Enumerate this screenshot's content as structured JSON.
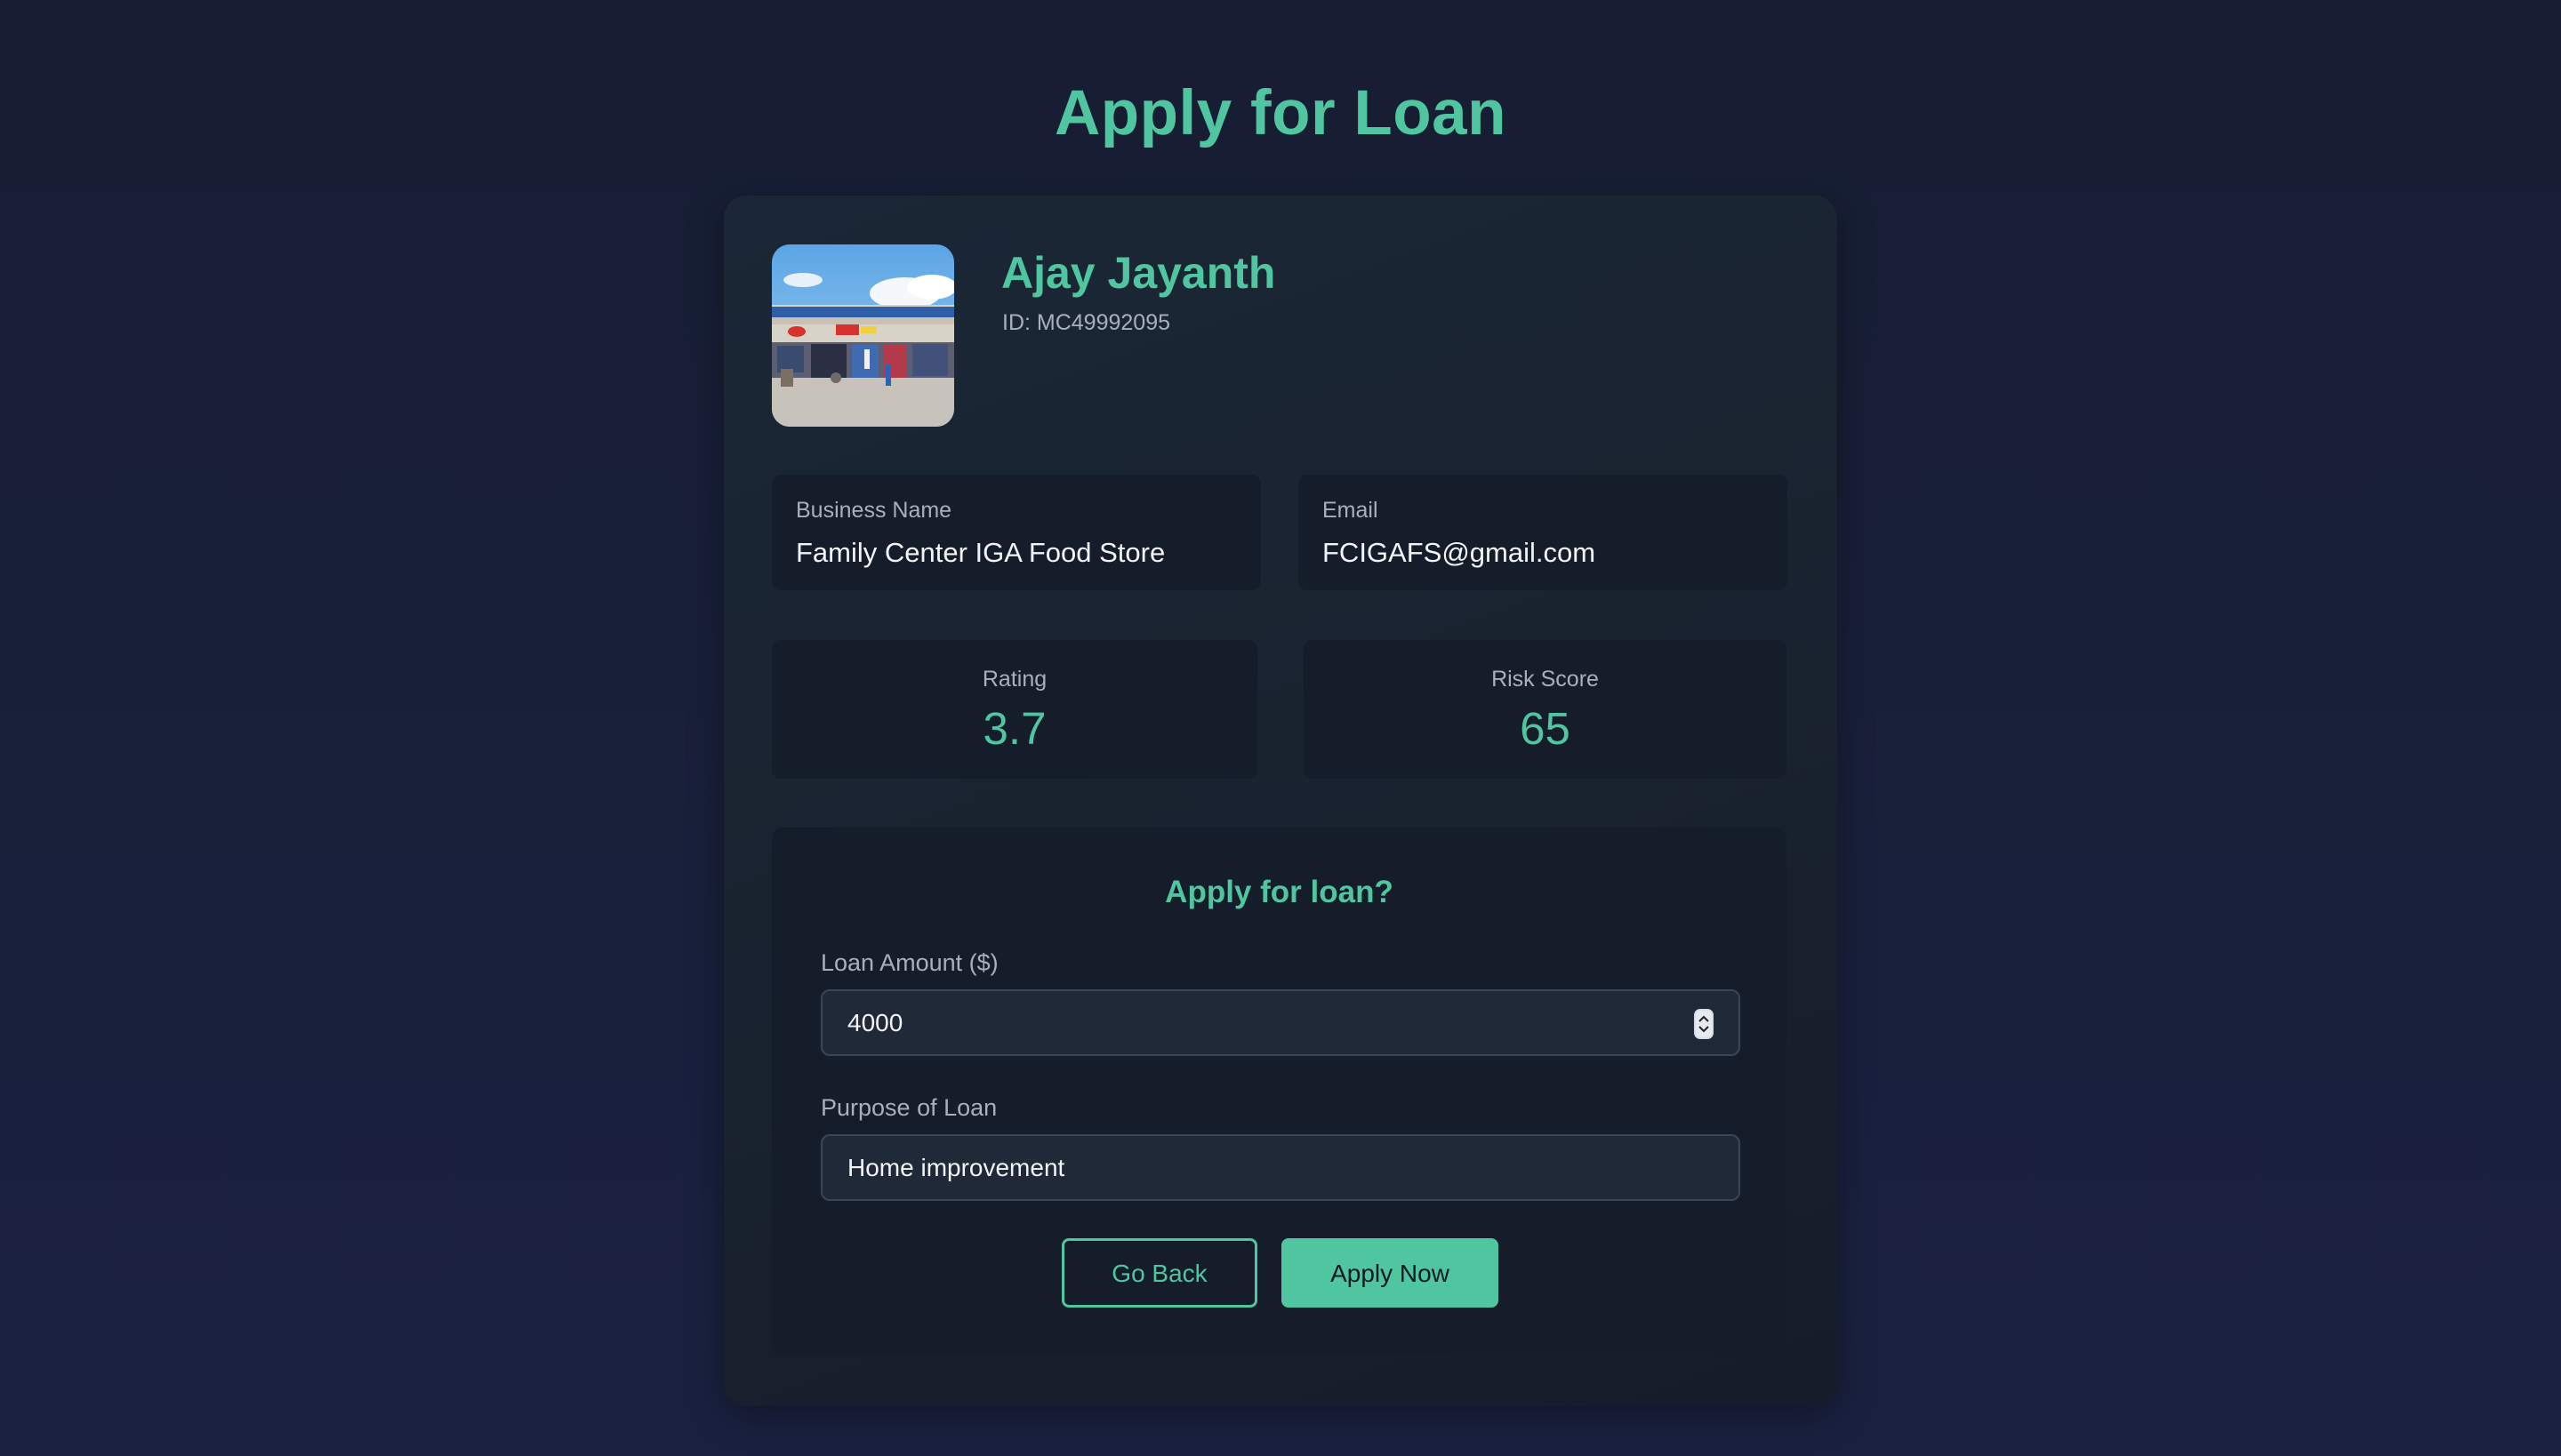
{
  "page": {
    "title": "Apply for Loan"
  },
  "profile": {
    "name": "Ajay Jayanth",
    "id_text": "ID: MC49992095",
    "avatar_image": "storefront photo"
  },
  "info": {
    "business_label": "Business Name",
    "business_value": "Family Center IGA Food Store",
    "email_label": "Email",
    "email_value": "FCIGAFS@gmail.com"
  },
  "stats": {
    "rating_label": "Rating",
    "rating_value": "3.7",
    "risk_label": "Risk Score",
    "risk_value": "65"
  },
  "loan_form": {
    "title": "Apply for loan?",
    "amount_label": "Loan Amount ($)",
    "amount_value": "4000",
    "purpose_label": "Purpose of Loan",
    "purpose_value": "Home improvement",
    "back_button": "Go Back",
    "apply_button": "Apply Now"
  },
  "colors": {
    "accent": "#4fc6a0",
    "background": "#171e33",
    "card": "#19222f"
  },
  "icons": {
    "spinner": "number-spinner-icon"
  }
}
